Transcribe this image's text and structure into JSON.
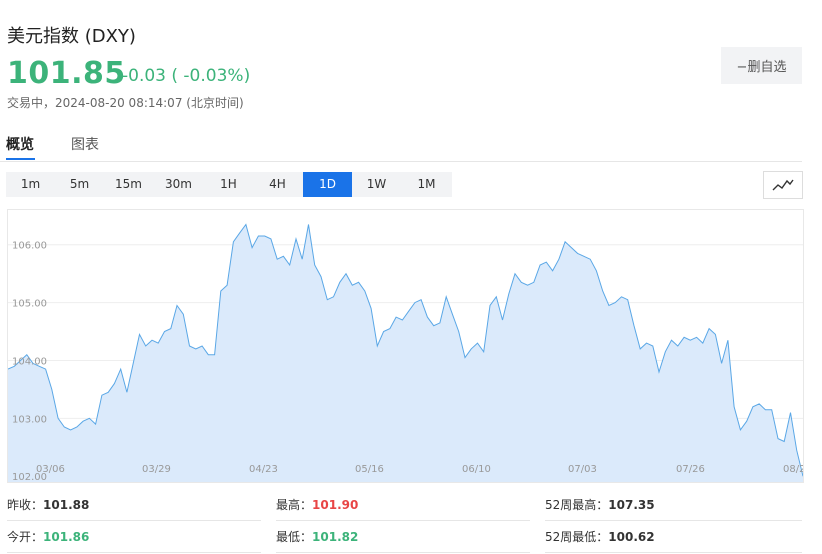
{
  "header": {
    "title": "美元指数 (DXY)",
    "price": "101.85",
    "change": "-0.03 ( -0.03%)",
    "status": "交易中，2024-08-20 08:14:07 (北京时间)",
    "watch_label": "−删自选"
  },
  "tabs": [
    "概览",
    "图表"
  ],
  "periods": [
    "1m",
    "5m",
    "15m",
    "30m",
    "1H",
    "4H",
    "1D",
    "1W",
    "1M"
  ],
  "active_period": "1D",
  "colors": {
    "up": "#e84545",
    "down": "#3cb37a",
    "accent": "#1a73e8",
    "line": "#5aa7e6",
    "fill": "#dbeafb"
  },
  "stats": {
    "prev_close": {
      "label": "昨收：",
      "value": "101.88"
    },
    "high": {
      "label": "最高：",
      "value": "101.90"
    },
    "high_52w": {
      "label": "52周最高：",
      "value": "107.35"
    },
    "open": {
      "label": "今开：",
      "value": "101.86"
    },
    "low": {
      "label": "最低：",
      "value": "101.82"
    },
    "low_52w": {
      "label": "52周最低：",
      "value": "100.62"
    }
  },
  "chart_data": {
    "type": "area",
    "ylim": [
      101.9,
      106.6
    ],
    "yticks": [
      "106.00",
      "105.00",
      "104.00",
      "103.00",
      "102.00"
    ],
    "xticks": [
      "03/06",
      "03/29",
      "04/23",
      "05/16",
      "06/10",
      "07/03",
      "07/26",
      "08/2"
    ],
    "grid": true,
    "values": [
      103.85,
      103.9,
      104.0,
      104.1,
      103.95,
      103.9,
      103.85,
      103.5,
      103.0,
      102.85,
      102.8,
      102.85,
      102.95,
      103.0,
      102.9,
      103.4,
      103.45,
      103.6,
      103.85,
      103.45,
      103.95,
      104.45,
      104.25,
      104.35,
      104.3,
      104.5,
      104.55,
      104.95,
      104.8,
      104.25,
      104.2,
      104.25,
      104.1,
      104.1,
      105.2,
      105.3,
      106.05,
      106.2,
      106.35,
      105.95,
      106.15,
      106.15,
      106.1,
      105.75,
      105.8,
      105.65,
      106.1,
      105.75,
      106.35,
      105.65,
      105.45,
      105.05,
      105.1,
      105.35,
      105.5,
      105.3,
      105.35,
      105.2,
      104.9,
      104.25,
      104.5,
      104.55,
      104.75,
      104.7,
      104.85,
      105.0,
      105.05,
      104.75,
      104.6,
      104.65,
      105.1,
      104.8,
      104.5,
      104.05,
      104.2,
      104.3,
      104.15,
      104.95,
      105.1,
      104.7,
      105.15,
      105.5,
      105.35,
      105.3,
      105.35,
      105.65,
      105.7,
      105.55,
      105.75,
      106.05,
      105.95,
      105.85,
      105.8,
      105.75,
      105.55,
      105.2,
      104.95,
      105.0,
      105.1,
      105.05,
      104.6,
      104.2,
      104.3,
      104.25,
      103.8,
      104.15,
      104.35,
      104.25,
      104.4,
      104.35,
      104.4,
      104.3,
      104.55,
      104.45,
      103.95,
      104.35,
      103.2,
      102.8,
      102.95,
      103.2,
      103.25,
      103.15,
      103.15,
      102.65,
      102.6,
      103.1,
      102.45,
      102.0
    ]
  }
}
